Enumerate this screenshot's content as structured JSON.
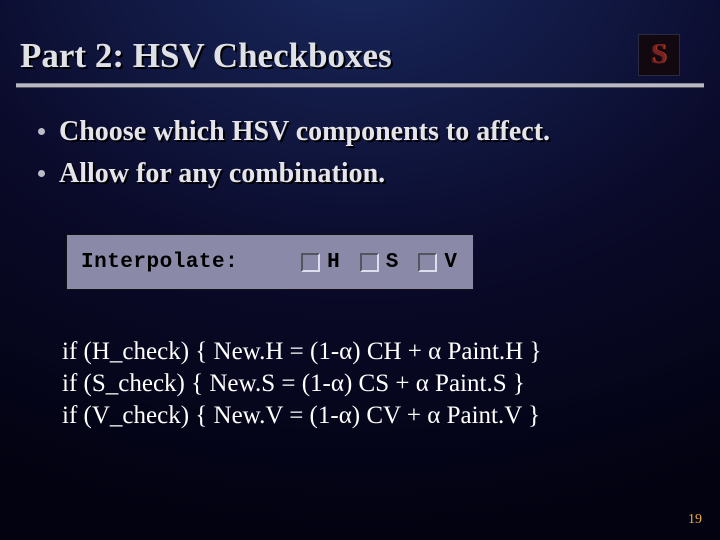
{
  "title": "Part 2: HSV Checkboxes",
  "logo_letter": "S",
  "bullets": [
    "Choose which HSV components to affect.",
    "Allow for any combination."
  ],
  "panel": {
    "label": "Interpolate:",
    "checkboxes": [
      {
        "label": "H",
        "checked": false
      },
      {
        "label": "S",
        "checked": false
      },
      {
        "label": "V",
        "checked": false
      }
    ]
  },
  "code_lines": [
    "if (H_check) { New.H = (1-α) CH + α Paint.H }",
    "if (S_check) { New.S = (1-α) CS + α Paint.S }",
    "if (V_check) { New.V = (1-α) CV + α Paint.V }"
  ],
  "page_number": "19"
}
